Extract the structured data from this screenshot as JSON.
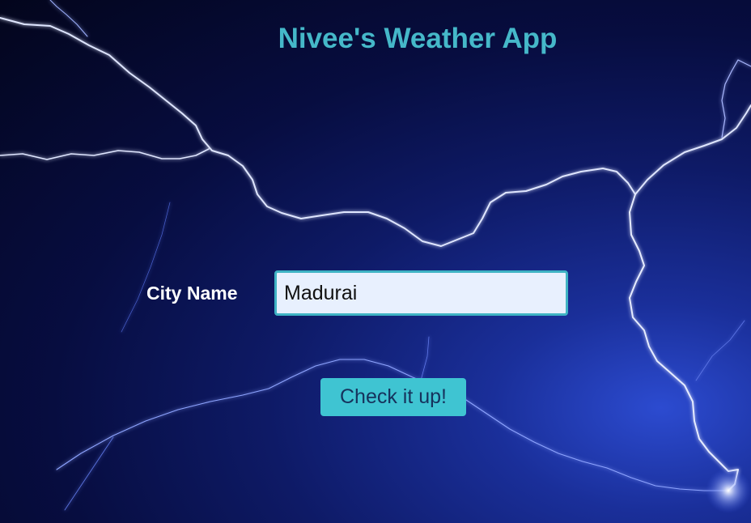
{
  "header": {
    "title": "Nivee's Weather App"
  },
  "form": {
    "city_label": "City Name",
    "city_value": "Madurai",
    "submit_label": "Check it up!"
  },
  "colors": {
    "title": "#45b8c9",
    "input_border": "#3fb3c4",
    "input_background": "#e8f0fe",
    "button_background": "#3fc4d2",
    "button_text": "#16325c",
    "background": "#070d40"
  },
  "background_image": "lightning-storm"
}
